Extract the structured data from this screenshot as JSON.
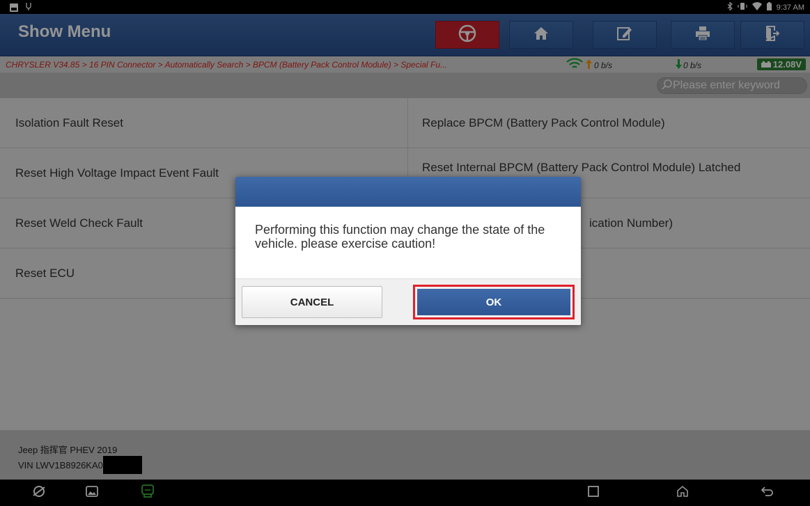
{
  "status_bar": {
    "time": "9:37 AM",
    "icons": [
      "notification-image-icon",
      "usb-icon",
      "bluetooth-icon",
      "vibrate-icon",
      "wifi-icon",
      "battery-icon"
    ]
  },
  "header": {
    "title": "Show Menu",
    "toolbar_icons": [
      "steering-wheel-icon",
      "home-icon",
      "edit-report-icon",
      "print-icon",
      "exit-icon"
    ],
    "active_color": "#c8202c",
    "accent_color": "#2f5b9a"
  },
  "breadcrumb": {
    "path": "CHRYSLER V34.85 > 16 PIN Connector > Automatically Search > BPCM (Battery Pack Control Module) > Special Fu...",
    "upload_rate": "0 b/s",
    "download_rate": "0 b/s",
    "voltage": "12.08V"
  },
  "search": {
    "placeholder": "Please enter keyword"
  },
  "menu": {
    "left": [
      "Isolation Fault Reset",
      "Reset High Voltage Impact Event Fault",
      "Reset Weld Check Fault",
      "Reset ECU"
    ],
    "right": [
      "Replace BPCM (Battery Pack Control Module)",
      "Reset Internal BPCM (Battery Pack Control Module) Latched",
      "ication Number)"
    ]
  },
  "vehicle": {
    "name": "Jeep 指挥官 PHEV 2019",
    "vin_prefix": "VIN LWV1B8926KA0"
  },
  "dialog": {
    "message": "Performing this function may change the state of the vehicle. please exercise caution!",
    "cancel_label": "CANCEL",
    "ok_label": "OK",
    "highlight_color": "#e0202a"
  },
  "nav_bar": {
    "icons": [
      "browser-icon",
      "gallery-icon",
      "vci-icon",
      "recents-icon",
      "home-nav-icon",
      "back-icon"
    ]
  }
}
